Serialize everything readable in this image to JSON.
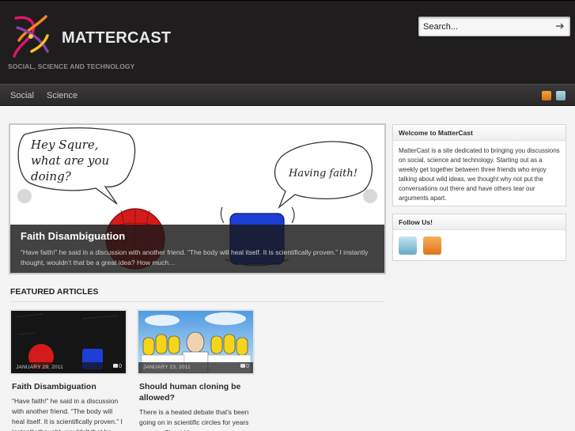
{
  "header": {
    "site_name": "MATTERCAST",
    "tagline": "SOCIAL, SCIENCE AND TECHNOLOGY",
    "search_placeholder": "Search..."
  },
  "nav": {
    "items": [
      "Social",
      "Science"
    ]
  },
  "slider": {
    "speech_left": [
      "Hey Squre,",
      "what are you",
      "doing?"
    ],
    "speech_right": "Having faith!",
    "title": "Faith Disambiguation",
    "excerpt": "“Have faith!” he said in a discussion with another friend. “The body will heal itself. It is scientifically proven.” I instantly thought, wouldn’t that be a great idea? How much…"
  },
  "featured": {
    "heading": "FEATURED ARTICLES",
    "articles": [
      {
        "date": "JANUARY 29, 2011",
        "comments": "0",
        "title": "Faith Disambiguation",
        "excerpt": "“Have faith!” he said in a discussion with another friend. “The body will heal itself. It is scientifically proven.” I instantly thought, wouldn’t that be"
      },
      {
        "date": "JANUARY 23, 2011",
        "comments": "0",
        "title": "Should human cloning be allowed?",
        "excerpt": "There is a heated debate that’s been going on in scientific circles for years now on. Should human"
      }
    ]
  },
  "sidebar": {
    "welcome_title": "Welcome to MatterCast",
    "welcome_text": "MatterCast is a site dedicated to bringing you discussions on social, science and technology. Starting out as a weekly get together between three friends who enjoy talking about wild ideas, we thought why not put the conversations out there and have others tear our arguments apart.",
    "follow_title": "Follow Us!"
  },
  "colors": {
    "header_bg": "#1f1d1d",
    "nav_bg": "#2e2c2c",
    "page_bg": "#f4f4f4",
    "rss_orange": "#e0721a",
    "twitter_blue": "#6aa9c7"
  }
}
